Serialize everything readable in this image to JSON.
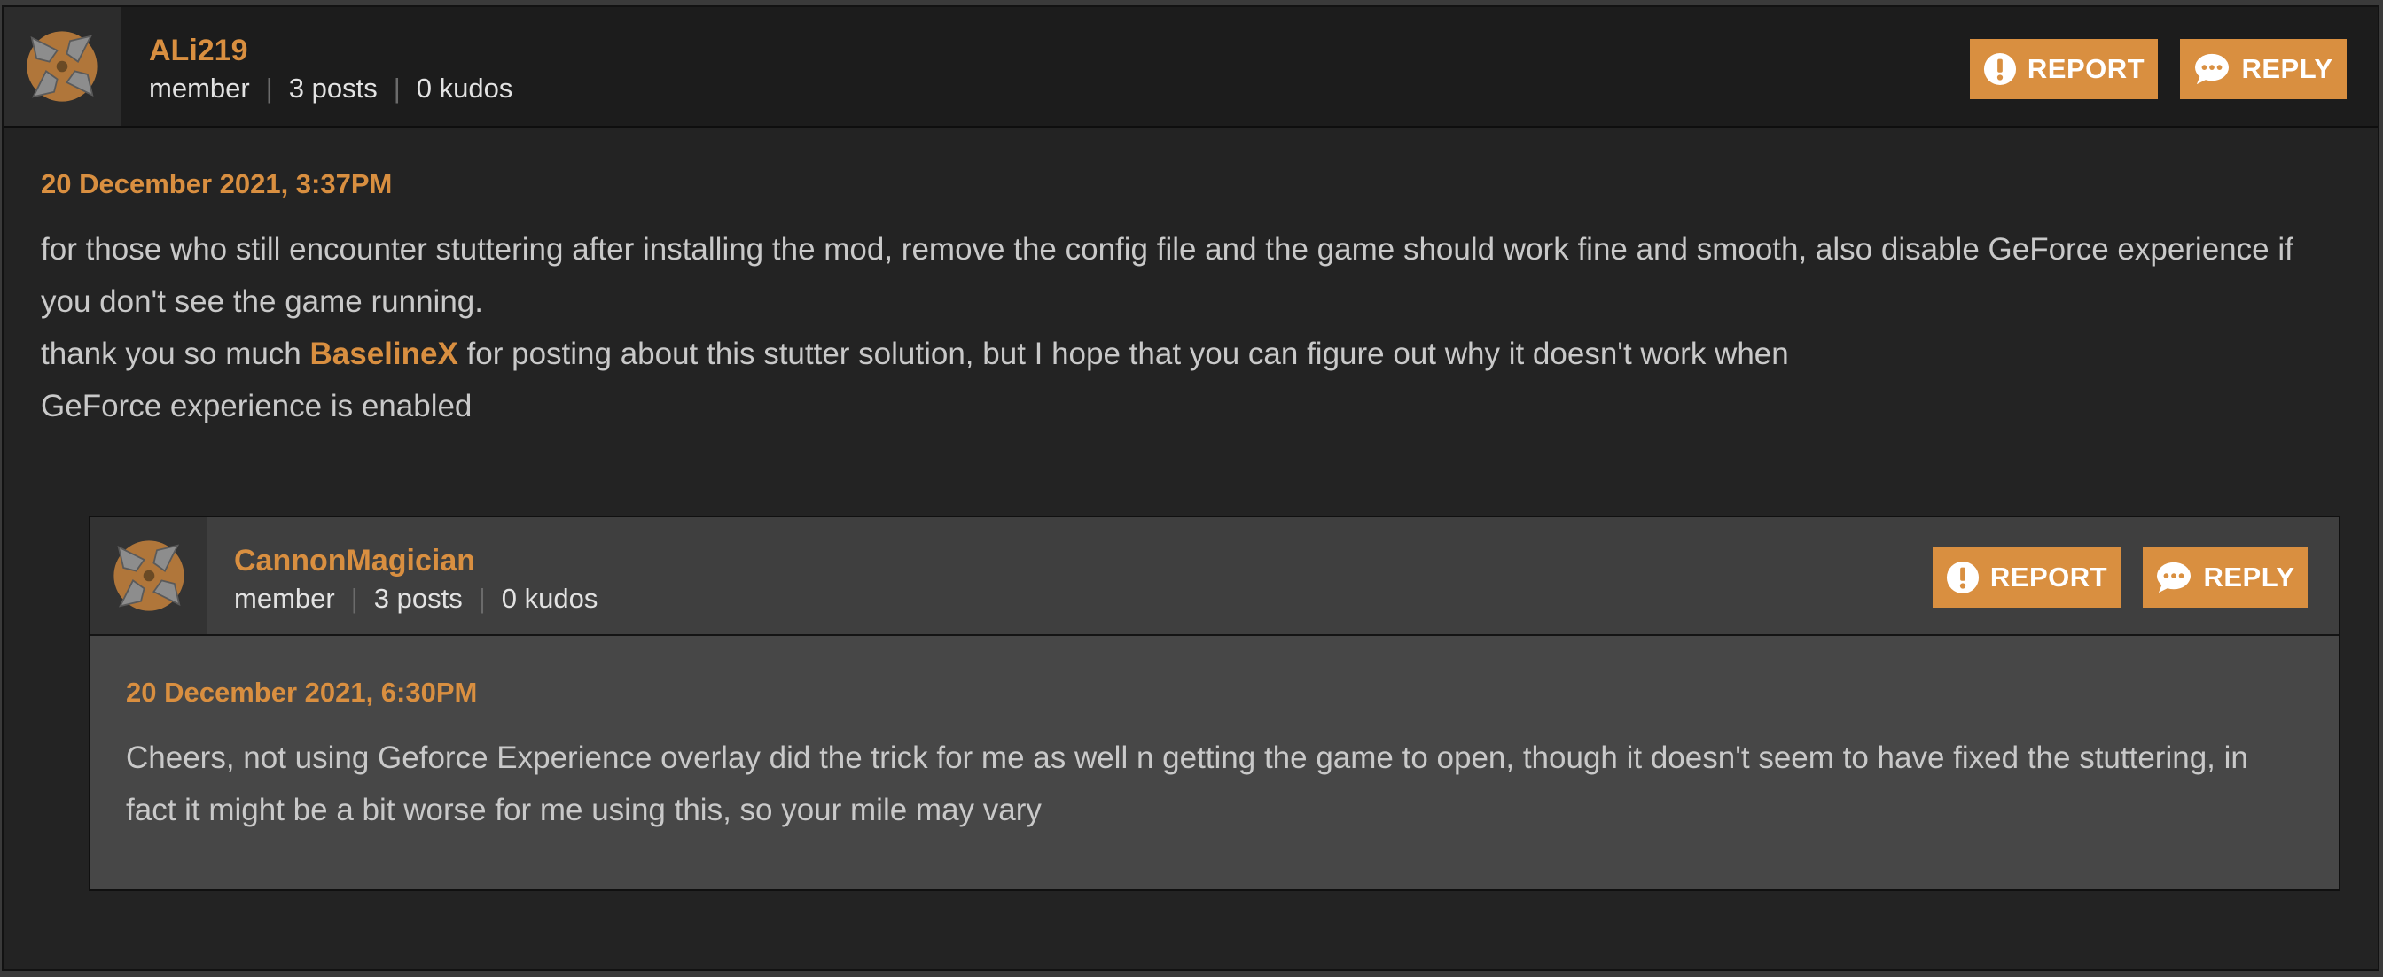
{
  "comment": {
    "author": {
      "name": "ALi219",
      "role": "member",
      "posts": "3 posts",
      "kudos": "0 kudos"
    },
    "actions": {
      "report_label": "REPORT",
      "reply_label": "REPLY"
    },
    "date": "20 December 2021, 3:37PM",
    "text": {
      "line1": "for those who still encounter stuttering after installing the mod, remove the config file and the game should work fine and smooth, also disable GeForce experience if you don't see the game running.",
      "line2_before": "thank you so much ",
      "mention": "BaselineX",
      "line2_after": " for posting about this stutter solution, but I hope that you can figure out why it doesn't work when",
      "line3": "GeForce experience is enabled"
    }
  },
  "reply": {
    "author": {
      "name": "CannonMagician",
      "role": "member",
      "posts": "3 posts",
      "kudos": "0 kudos"
    },
    "actions": {
      "report_label": "REPORT",
      "reply_label": "REPLY"
    },
    "date": "20 December 2021, 6:30PM",
    "text": "Cheers, not using Geforce Experience overlay did the trick for me as well n getting the game to open, though it doesn't seem to have fixed the stuttering, in fact it might be a bit worse for me using this, so your mile may vary"
  },
  "colors": {
    "accent": "#d98f40",
    "background": "#232323",
    "header": "#1c1c1c",
    "reply_background": "#474747",
    "text": "#c9c9c9"
  },
  "icons": [
    "nexus-logo-icon",
    "exclamation-circle-icon",
    "speech-bubble-icon"
  ]
}
